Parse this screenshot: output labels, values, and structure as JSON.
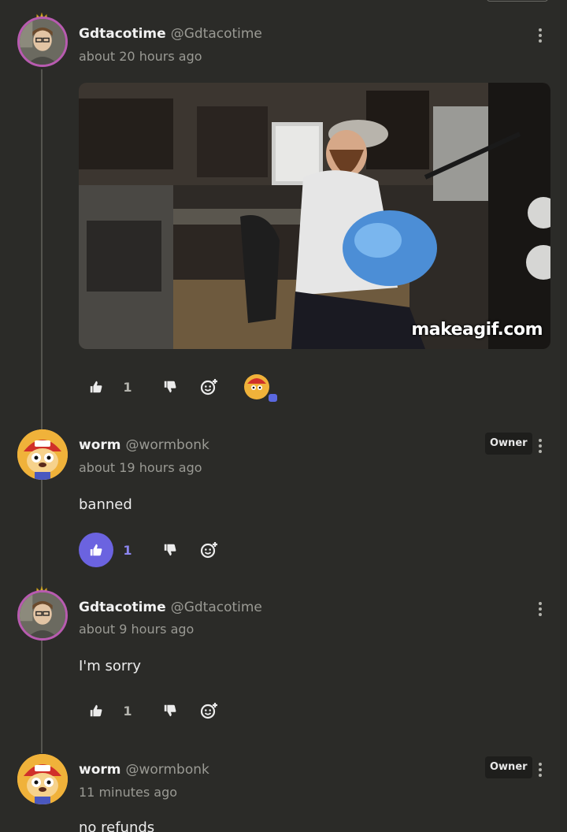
{
  "comments": [
    {
      "author": "Gdtacotime",
      "handle": "@Gdtacotime",
      "time": "about 20 hours ago",
      "gif_watermark": "makeagif.com",
      "likes": "1",
      "liked": false,
      "reaction_avatar": "worm-avatar"
    },
    {
      "author": "worm",
      "handle": "@wormbonk",
      "time": "about 19 hours ago",
      "badge": "Owner",
      "text": "banned",
      "likes": "1",
      "liked": true
    },
    {
      "author": "Gdtacotime",
      "handle": "@Gdtacotime",
      "time": "about 9 hours ago",
      "text": "I'm sorry",
      "likes": "1",
      "liked": false
    },
    {
      "author": "worm",
      "handle": "@wormbonk",
      "time": "11 minutes ago",
      "badge": "Owner",
      "text": "no refunds"
    }
  ],
  "colors": {
    "background": "#2b2b28",
    "accent_like": "#6b63e0",
    "avatar_ring": "#b85bb0"
  },
  "icons": [
    "thumbs-up-icon",
    "thumbs-down-icon",
    "add-reaction-icon",
    "more-vertical-icon",
    "crown-icon"
  ]
}
